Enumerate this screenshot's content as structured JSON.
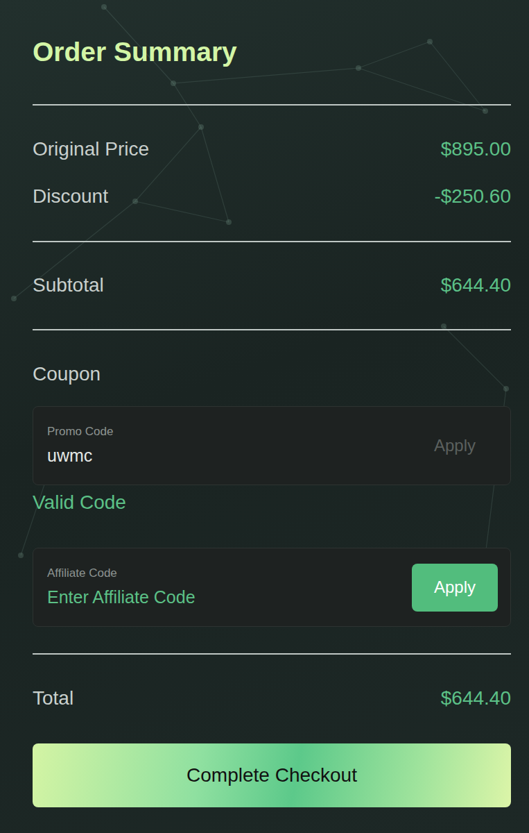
{
  "title": "Order Summary",
  "price_rows": [
    {
      "label": "Original Price",
      "value": "$895.00"
    },
    {
      "label": "Discount",
      "value": "-$250.60"
    }
  ],
  "subtotal": {
    "label": "Subtotal",
    "value": "$644.40"
  },
  "coupon": {
    "heading": "Coupon",
    "promo": {
      "label": "Promo Code",
      "value": "uwmc",
      "button": "Apply",
      "button_disabled": true,
      "status": "Valid Code"
    },
    "affiliate": {
      "label": "Affiliate Code",
      "placeholder": "Enter Affiliate Code",
      "value": "",
      "button": "Apply",
      "button_disabled": false
    }
  },
  "total": {
    "label": "Total",
    "value": "$644.40"
  },
  "checkout_button": "Complete Checkout"
}
